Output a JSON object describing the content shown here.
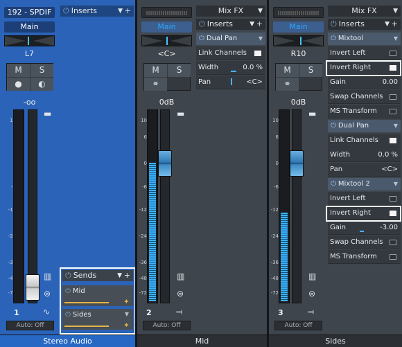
{
  "channels": [
    {
      "name": "Stereo Audio",
      "io_top": "192 - SPDIF",
      "io_bottom": "Main",
      "pan_label": "L7",
      "mute": "M",
      "solo": "S",
      "volume": "-oo",
      "number": "1",
      "automation": "Auto: Off",
      "inserts_label": "Inserts",
      "sends": {
        "label": "Sends",
        "items": [
          {
            "name": "Mid"
          },
          {
            "name": "Sides"
          }
        ]
      }
    },
    {
      "name": "Mid",
      "io_bottom": "Main",
      "pan_label": "<C>",
      "mute": "M",
      "solo": "S",
      "volume": "0dB",
      "number": "2",
      "automation": "Auto: Off",
      "mixfx": "Mix FX",
      "inserts_label": "Inserts",
      "plugin": "Dual Pan",
      "params": [
        {
          "label": "Link Channels",
          "type": "toggle",
          "on": true
        },
        {
          "label": "Width",
          "value": "0.0 %"
        },
        {
          "label": "Pan",
          "value": "<C>"
        }
      ]
    },
    {
      "name": "Sides",
      "io_bottom": "Main",
      "pan_label": "R10",
      "mute": "M",
      "solo": "S",
      "volume": "0dB",
      "number": "3",
      "automation": "Auto: Off",
      "mixfx": "Mix FX",
      "inserts_label": "Inserts",
      "plugins": [
        {
          "name": "Mixtool",
          "params": [
            {
              "label": "Invert Left",
              "type": "toggle",
              "on": false
            },
            {
              "label": "Invert Right",
              "type": "toggle",
              "on": true
            },
            {
              "label": "Gain",
              "value": "0.00"
            },
            {
              "label": "Swap Channels",
              "type": "toggle",
              "on": false
            },
            {
              "label": "MS Transform",
              "type": "toggle",
              "on": false
            }
          ]
        },
        {
          "name": "Dual Pan",
          "params": [
            {
              "label": "Link Channels",
              "type": "toggle",
              "on": true
            },
            {
              "label": "Width",
              "value": "0.0 %"
            },
            {
              "label": "Pan",
              "value": "<C>"
            }
          ]
        },
        {
          "name": "Mixtool 2",
          "params": [
            {
              "label": "Invert Left",
              "type": "toggle",
              "on": false
            },
            {
              "label": "Invert Right",
              "type": "toggle",
              "on": true
            },
            {
              "label": "Gain",
              "value": "-3.00"
            },
            {
              "label": "Swap Channels",
              "type": "toggle",
              "on": false
            },
            {
              "label": "MS Transform",
              "type": "toggle",
              "on": false
            }
          ]
        }
      ]
    }
  ],
  "meter_scale": [
    "10",
    "6",
    "0",
    "-6",
    "-12",
    "-24",
    "-36",
    "-48",
    "-72"
  ],
  "meter_levels": {
    "ch1": 0,
    "ch2": 0.72,
    "ch3": 0.46
  },
  "colors": {
    "selected_strip": "#2a63b8",
    "meter": "#3ab4ff",
    "send_level": "#e4b54b",
    "highlight": "#ffffff"
  }
}
